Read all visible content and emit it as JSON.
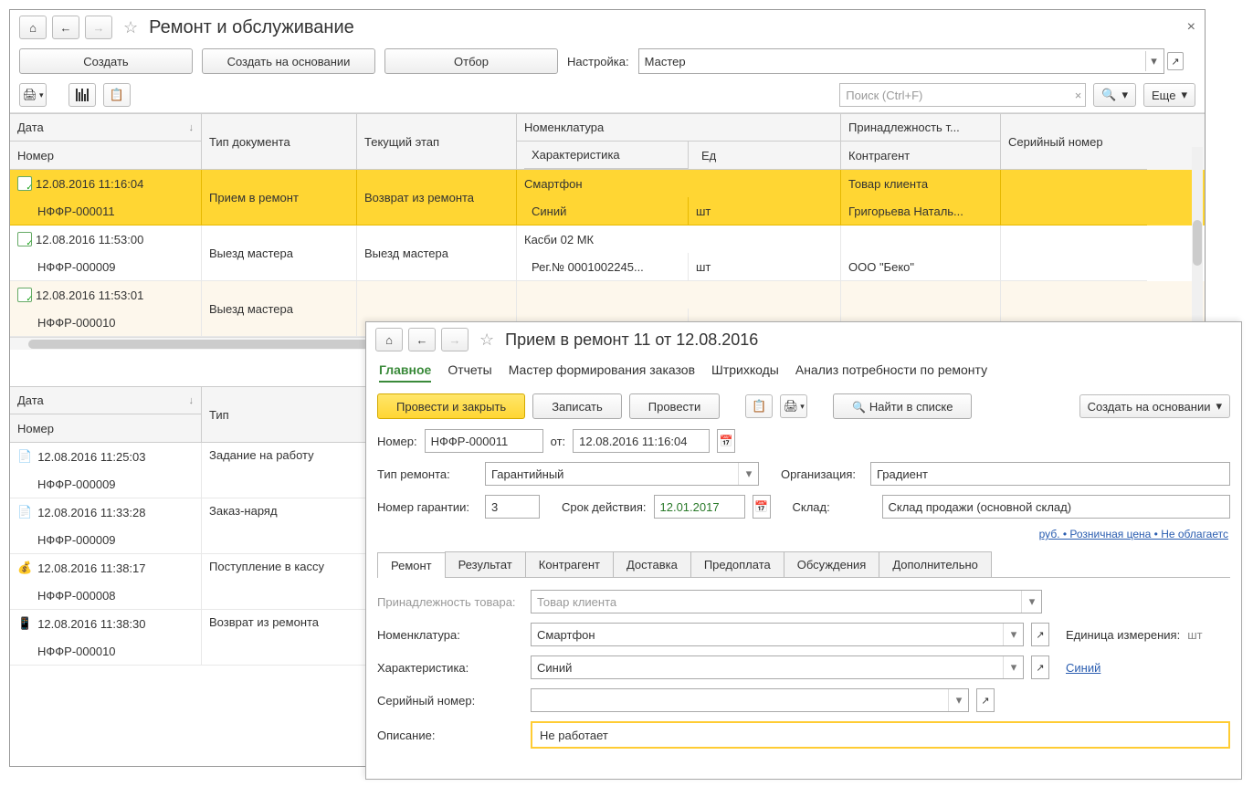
{
  "main": {
    "title": "Ремонт и обслуживание",
    "toolbar": {
      "create": "Создать",
      "create_based": "Создать на основании",
      "filter": "Отбор",
      "setting_label": "Настройка:",
      "setting_value": "Мастер",
      "search_placeholder": "Поиск (Ctrl+F)",
      "more": "Еще"
    },
    "grid_headers": {
      "date": "Дата",
      "number": "Номер",
      "doc_type": "Тип документа",
      "stage": "Текущий этап",
      "nomenclature": "Номенклатура",
      "characteristic": "Характеристика",
      "unit": "Ед",
      "ownership": "Принадлежность т...",
      "counterparty": "Контрагент",
      "serial": "Серийный номер"
    },
    "rows": [
      {
        "date": "12.08.2016 11:16:04",
        "number": "НФФР-000011",
        "doc_type": "Прием в ремонт",
        "stage": "Возврат из ремонта",
        "nomenclature": "Смартфон",
        "characteristic": "Синий",
        "unit": "шт",
        "ownership": "Товар клиента",
        "counterparty": "Григорьева Наталь...",
        "selected": true
      },
      {
        "date": "12.08.2016 11:53:00",
        "number": "НФФР-000009",
        "doc_type": "Выезд мастера",
        "stage": "Выезд мастера",
        "nomenclature": "Касби 02 МК",
        "characteristic": "Рег.№ 0001002245...",
        "unit": "шт",
        "ownership": "",
        "counterparty": "ООО \"Беко\""
      },
      {
        "date": "12.08.2016 11:53:01",
        "number": "НФФР-000010",
        "doc_type": "Выезд мастера",
        "stage": "",
        "nomenclature": "",
        "characteristic": "",
        "unit": "",
        "ownership": "",
        "counterparty": "",
        "alt": true
      }
    ],
    "grid2_headers": {
      "date": "Дата",
      "number": "Номер",
      "type": "Тип"
    },
    "grid2_rows": [
      {
        "date": "12.08.2016 11:25:03",
        "number": "НФФР-000009",
        "type": "Задание на работу",
        "icon": "doc-green"
      },
      {
        "date": "12.08.2016 11:33:28",
        "number": "НФФР-000009",
        "type": "Заказ-наряд",
        "icon": "doc-green"
      },
      {
        "date": "12.08.2016 11:38:17",
        "number": "НФФР-000008",
        "type": "Поступление в кассу",
        "icon": "cash"
      },
      {
        "date": "12.08.2016 11:38:30",
        "number": "НФФР-000010",
        "type": "Возврат из ремонта",
        "icon": "phone"
      }
    ]
  },
  "detail": {
    "title": "Прием в ремонт 11 от 12.08.2016",
    "top_tabs": {
      "main": "Главное",
      "reports": "Отчеты",
      "wizard": "Мастер формирования заказов",
      "barcodes": "Штрихкоды",
      "analysis": "Анализ потребности по ремонту"
    },
    "buttons": {
      "post_close": "Провести и закрыть",
      "save": "Записать",
      "post": "Провести",
      "find_list": "Найти в списке",
      "create_based": "Создать на основании"
    },
    "fields": {
      "number_label": "Номер:",
      "number": "НФФР-000011",
      "from_label": "от:",
      "from": "12.08.2016 11:16:04",
      "repair_type_label": "Тип ремонта:",
      "repair_type": "Гарантийный",
      "org_label": "Организация:",
      "org": "Градиент",
      "warranty_no_label": "Номер гарантии:",
      "warranty_no": "3",
      "valid_label": "Срок действия:",
      "valid": "12.01.2017",
      "warehouse_label": "Склад:",
      "warehouse": "Склад продажи (основной склад)",
      "price_link": "руб. • Розничная цена • Не облагаетс"
    },
    "tabs": {
      "repair": "Ремонт",
      "result": "Результат",
      "counterparty": "Контрагент",
      "delivery": "Доставка",
      "prepay": "Предоплата",
      "discuss": "Обсуждения",
      "extra": "Дополнительно"
    },
    "form": {
      "ownership_label": "Принадлежность товара:",
      "ownership": "Товар клиента",
      "nomenclature_label": "Номенклатура:",
      "nomenclature": "Смартфон",
      "unit_label": "Единица измерения:",
      "unit": "шт",
      "characteristic_label": "Характеристика:",
      "characteristic": "Синий",
      "characteristic_link": "Синий",
      "serial_label": "Серийный номер:",
      "serial": "",
      "description_label": "Описание:",
      "description": "Не работает"
    }
  }
}
